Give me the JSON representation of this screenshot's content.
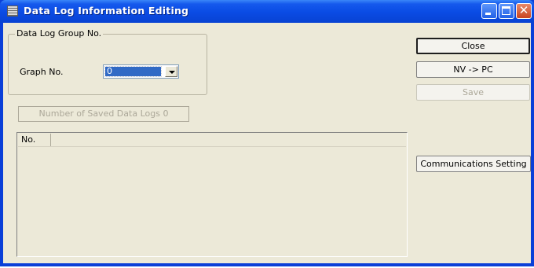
{
  "window": {
    "title": "Data Log Information Editing"
  },
  "group": {
    "legend": "Data Log Group No.",
    "graph_label": "Graph No.",
    "graph_value": "0"
  },
  "saved_logs": "Number of Saved Data Logs 0",
  "list": {
    "columns": [
      "No.",
      ""
    ]
  },
  "buttons": {
    "close": "Close",
    "nv_to_pc": "NV -> PC",
    "save": "Save",
    "comm": "Communications Setting"
  },
  "colors": {
    "titlebar": "#0a4be4",
    "window_bg": "#ece9d8",
    "selection": "#316ac5",
    "close_btn": "#c94421"
  }
}
